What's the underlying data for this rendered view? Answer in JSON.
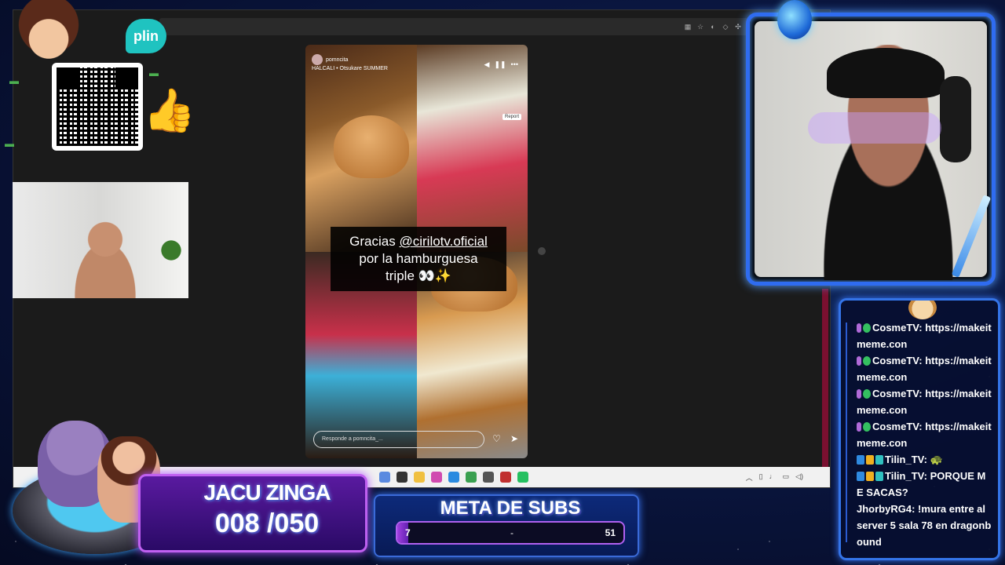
{
  "browser": {
    "toolbar_icons": [
      "grid-icon",
      "star-icon",
      "shield-icon",
      "extension-icon",
      "puzzle-icon"
    ]
  },
  "story": {
    "username": "pomncita",
    "music": "HALCALI • Otsukare SUMMER",
    "report_label": "Report",
    "caption": {
      "line1_prefix": "Gracias ",
      "mention": "@cirilotv.oficial",
      "line2": "por la hamburguesa",
      "line3": "triple 👀✨"
    },
    "reply_placeholder": "Responde a pomncita_...",
    "icons": [
      "heart-icon",
      "send-icon"
    ]
  },
  "overlay": {
    "plin_label": "plin",
    "counter": {
      "title": "JACU ZINGA",
      "value": "008 /050"
    },
    "meta": {
      "title": "META DE SUBS",
      "min": "7",
      "mid": "-",
      "max": "51",
      "progress_fraction": 0.05
    }
  },
  "chat": {
    "messages": [
      {
        "badges": [
          "mic",
          "check"
        ],
        "user": "CosmeTV:",
        "text": "https://makeitmeme.con"
      },
      {
        "badges": [
          "mic",
          "check"
        ],
        "user": "CosmeTV:",
        "text": "https://makeitmeme.con"
      },
      {
        "badges": [
          "mic",
          "check"
        ],
        "user": "CosmeTV:",
        "text": "https://makeitmeme.con"
      },
      {
        "badges": [
          "mic",
          "check"
        ],
        "user": "CosmeTV:",
        "text": "https://makeitmeme.con"
      },
      {
        "badges": [
          "sub",
          "crown",
          "gem"
        ],
        "user": "Tilin_TV:",
        "text": "🐢"
      },
      {
        "badges": [
          "sub",
          "crown",
          "gem"
        ],
        "user": "Tilin_TV:",
        "text": "PORQUE ME SACAS?"
      },
      {
        "badges": [],
        "user": "JhorbyRG4:",
        "text": "!mura entre al server 5 sala 78 en dragonbound"
      }
    ]
  },
  "colors": {
    "frame_blue": "#2f6cf0",
    "counter_purple": "#5a1aa0",
    "plin_teal": "#1fc3c0",
    "progress_fill": "#a040e0"
  }
}
